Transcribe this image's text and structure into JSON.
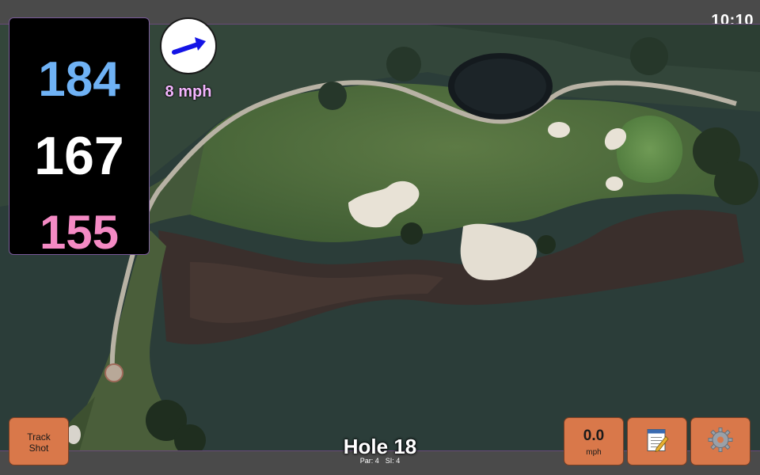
{
  "status": {
    "time": "10:10"
  },
  "distances": {
    "back": "184",
    "center": "167",
    "front": "155",
    "colors": {
      "back": "#6fb2f5",
      "center": "#ffffff",
      "front": "#f48ac4"
    }
  },
  "wind": {
    "speed": "8 mph",
    "direction_icon": "arrow-icon",
    "arrow_color": "#1414e6"
  },
  "buttons": {
    "track_shot_line1": "Track",
    "track_shot_line2": "Shot",
    "speed_value": "0.0",
    "speed_unit": "mph",
    "notes_icon": "notepad-icon",
    "settings_icon": "gear-icon",
    "color": "#d9784a"
  },
  "hole": {
    "title": "Hole 18",
    "par": "Par: 4",
    "si": "SI: 4"
  }
}
